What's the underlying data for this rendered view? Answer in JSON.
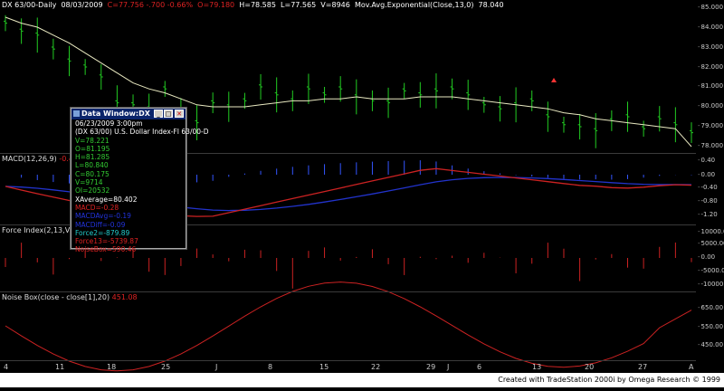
{
  "header": {
    "symbol": "DX 63/00-Daily",
    "date": "08/03/2009",
    "change": "C=77.756  -.700  -0.66%",
    "open": "O=79.180",
    "high": "H=78.585",
    "low": "L=77.565",
    "volume": "V=8946",
    "study": "Mov.Avg.Exponential(Close,13,0)",
    "study_value": "78.040"
  },
  "panes": {
    "macd_label": "MACD(12,26,9)",
    "macd_value": "-0.49",
    "force_label": "Force Index(2,13,Volume",
    "noise_label": "Noise Box(close - close[1],20)",
    "noise_value": "451.08"
  },
  "price_axis": [
    "85.000",
    "84.000",
    "83.000",
    "82.000",
    "81.000",
    "80.000",
    "79.000",
    "78.000"
  ],
  "macd_axis": [
    "0.40",
    "0.00",
    "-0.40",
    "-0.80",
    "-1.20"
  ],
  "force_axis": [
    "10000.00",
    "5000.00",
    "0.00",
    "-5000.00",
    "-10000.00"
  ],
  "noise_axis": [
    "650.00",
    "550.00",
    "450.00"
  ],
  "date_axis": [
    "4",
    "11",
    "18",
    "25",
    "J",
    "8",
    "15",
    "22",
    "29",
    "J",
    "6",
    "13",
    "20",
    "27",
    "A"
  ],
  "data_window": {
    "title": "Data Window:DX",
    "rows": [
      {
        "text": "06/23/2009  3:00pm",
        "color": "#ffffff"
      },
      {
        "text": "(DX 63/00) U.S. Dollar Index-FI 63/00-D",
        "color": "#ffffff"
      },
      {
        "text": "V=78.221",
        "color": "#33cc33"
      },
      {
        "text": "O=81.195",
        "color": "#33cc33"
      },
      {
        "text": "H=81.285",
        "color": "#33cc33"
      },
      {
        "text": "L=80.840",
        "color": "#33cc33"
      },
      {
        "text": "C=80.175",
        "color": "#33cc33"
      },
      {
        "text": "V=9714",
        "color": "#33cc33"
      },
      {
        "text": "OI=20532",
        "color": "#33cc33"
      },
      {
        "text": "XAverage=80.402",
        "color": "#ffffff"
      },
      {
        "text": "MACD=-0.28",
        "color": "#dd2222"
      },
      {
        "text": "MACDAvg=-0.19",
        "color": "#2233dd"
      },
      {
        "text": "MACDiff=-0.09",
        "color": "#2233dd"
      },
      {
        "text": "Force2=-879.89",
        "color": "#22cccc"
      },
      {
        "text": "Force13=-5739.87",
        "color": "#dd2222"
      },
      {
        "text": "NoiseBox=590.46",
        "color": "#dd2222"
      }
    ]
  },
  "footer": "Created with TradeStation 2000i by Omega Research © 1999",
  "colors": {
    "bars": "#22cc22",
    "ema": "#e8e8c0",
    "macd": "#cc2222",
    "signal": "#2233cc",
    "hist": "#3355ff",
    "force": "#cc2222",
    "noise": "#cc2222"
  },
  "chart_data": {
    "type": "line",
    "x": [
      "Jun 4",
      "Jun 11",
      "Jun 18",
      "Jun 25",
      "Jul 1",
      "Jul 8",
      "Jul 15",
      "Jul 22",
      "Jul 29",
      "Aug 3"
    ],
    "ylim": [
      77.6,
      85.2
    ],
    "series": [
      {
        "name": "Close",
        "values": [
          84.2,
          83.8,
          83.6,
          82.9,
          82.3,
          82.0,
          81.5,
          80.2,
          80.1,
          79.9,
          80.9,
          79.8,
          79.2,
          80.2,
          80.0,
          80.3,
          81.0,
          80.6,
          80.3,
          80.9,
          80.6,
          80.9,
          80.5,
          80.3,
          80.2,
          80.8,
          80.6,
          80.8,
          80.9,
          80.6,
          80.1,
          79.9,
          80.1,
          80.3,
          79.5,
          79.1,
          79.0,
          78.8,
          79.3,
          79.5,
          78.9,
          79.4,
          79.1,
          78.7
        ]
      },
      {
        "name": "EMA",
        "values": [
          84.5,
          84.2,
          84.0,
          83.6,
          83.2,
          82.7,
          82.2,
          81.7,
          81.2,
          80.9,
          80.7,
          80.4,
          80.1,
          80.0,
          80.0,
          80.0,
          80.1,
          80.2,
          80.3,
          80.3,
          80.4,
          80.4,
          80.5,
          80.4,
          80.4,
          80.4,
          80.5,
          80.5,
          80.5,
          80.4,
          80.3,
          80.2,
          80.1,
          80.0,
          79.9,
          79.7,
          79.6,
          79.4,
          79.3,
          79.2,
          79.1,
          79.0,
          78.9,
          78.0
        ]
      }
    ]
  }
}
